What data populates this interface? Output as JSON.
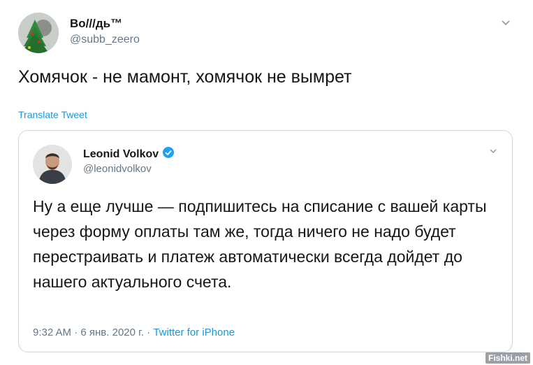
{
  "tweet": {
    "author_name": "Во///дь™",
    "author_handle": "@subb_zeero",
    "text": "Хомячок - не мамонт, хомячок не вымрет",
    "translate_label": "Translate Tweet",
    "avatar_icon": "christmas-tree-avatar-icon",
    "menu_icon": "chevron-down-icon"
  },
  "quoted": {
    "author_name": "Leonid Volkov",
    "author_handle": "@leonidvolkov",
    "text": "Ну а еще лучше — подпишитесь на списание с вашей карты через форму оплаты там же, тогда ничего не надо будет перестраивать и платеж автоматически всегда дойдет до нашего актуального счета.",
    "time": "9:32 AM",
    "separator": "·",
    "date": "6 янв. 2020 г.",
    "source": "Twitter for iPhone",
    "verified_icon": "verified-badge-icon",
    "avatar_icon": "profile-photo-avatar-icon",
    "menu_icon": "chevron-down-icon"
  },
  "watermark": "Fishki.net",
  "colors": {
    "text": "#14171a",
    "secondary": "#657786",
    "link": "#1b95e0",
    "border": "#ccd6dd"
  }
}
